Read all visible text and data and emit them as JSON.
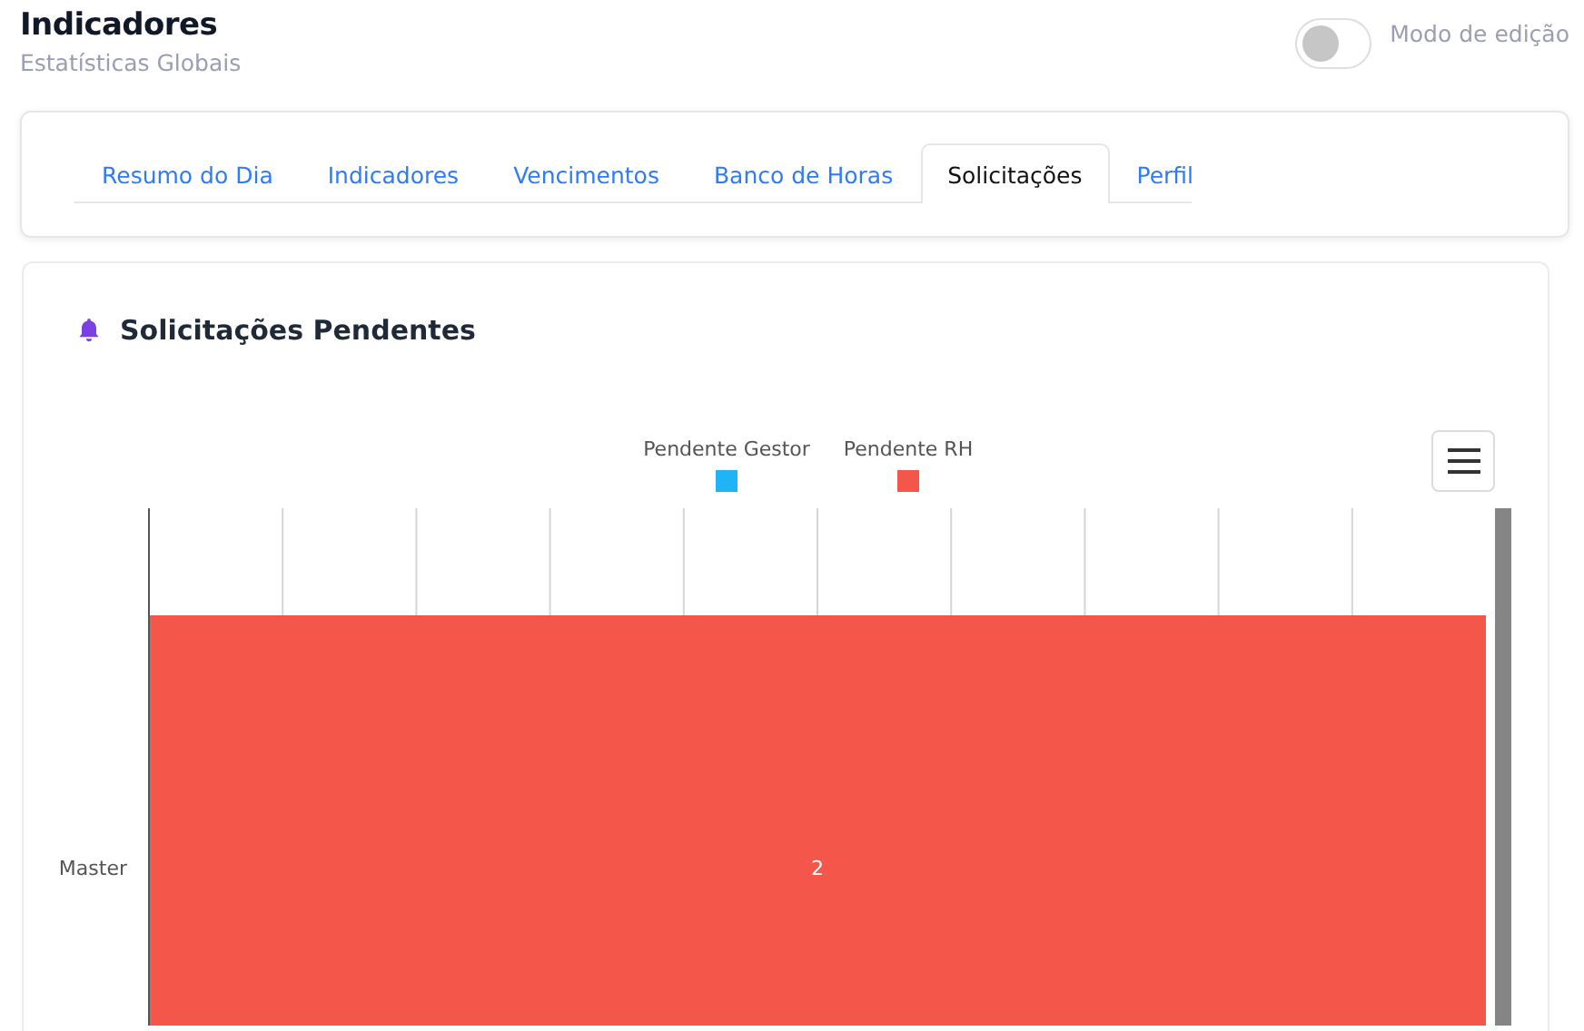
{
  "header": {
    "title": "Indicadores",
    "subtitle": "Estatísticas Globais"
  },
  "edit_mode": {
    "label": "Modo de edição",
    "on": false
  },
  "tabs": [
    {
      "label": "Resumo do Dia",
      "selected": false
    },
    {
      "label": "Indicadores",
      "selected": false
    },
    {
      "label": "Vencimentos",
      "selected": false
    },
    {
      "label": "Banco de Horas",
      "selected": false
    },
    {
      "label": "Solicitações",
      "selected": true
    },
    {
      "label": "Perfil",
      "selected": false
    }
  ],
  "panel": {
    "title": "Solicitações Pendentes",
    "chart": {
      "legend": [
        {
          "label": "Pendente Gestor",
          "color": "#1eb4f5"
        },
        {
          "label": "Pendente RH",
          "color": "#f4564a"
        }
      ],
      "rows": [
        {
          "label": "Master",
          "value": "2",
          "color": "#f4564a"
        }
      ]
    }
  }
}
